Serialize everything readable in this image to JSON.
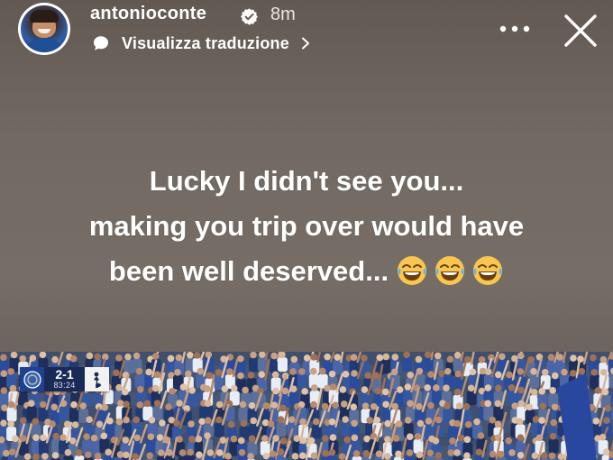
{
  "header": {
    "username": "antonioconte",
    "verified_icon": "verified-badge-icon",
    "timestamp": "8m",
    "translate": {
      "label": "Visualizza traduzione",
      "icon": "speech-bubble-icon",
      "chevron": "chevron-right-icon"
    },
    "more_icon": "more-horizontal-icon",
    "close_icon": "close-icon"
  },
  "caption": {
    "line1": "Lucky I didn't see you...",
    "line2": "making you trip over would have",
    "line3": "been well deserved...",
    "emoji": [
      "😂",
      "😂",
      "😂"
    ]
  },
  "scoreboard": {
    "score": "2-1",
    "clock": "83:24",
    "home_crest": "chelsea-crest-icon",
    "away_crest": "tottenham-crest-icon"
  },
  "colors": {
    "background": "#736b63",
    "text": "#ffffff",
    "score_bg": "#1a2a57",
    "home_blue": "#1f3f8f"
  }
}
